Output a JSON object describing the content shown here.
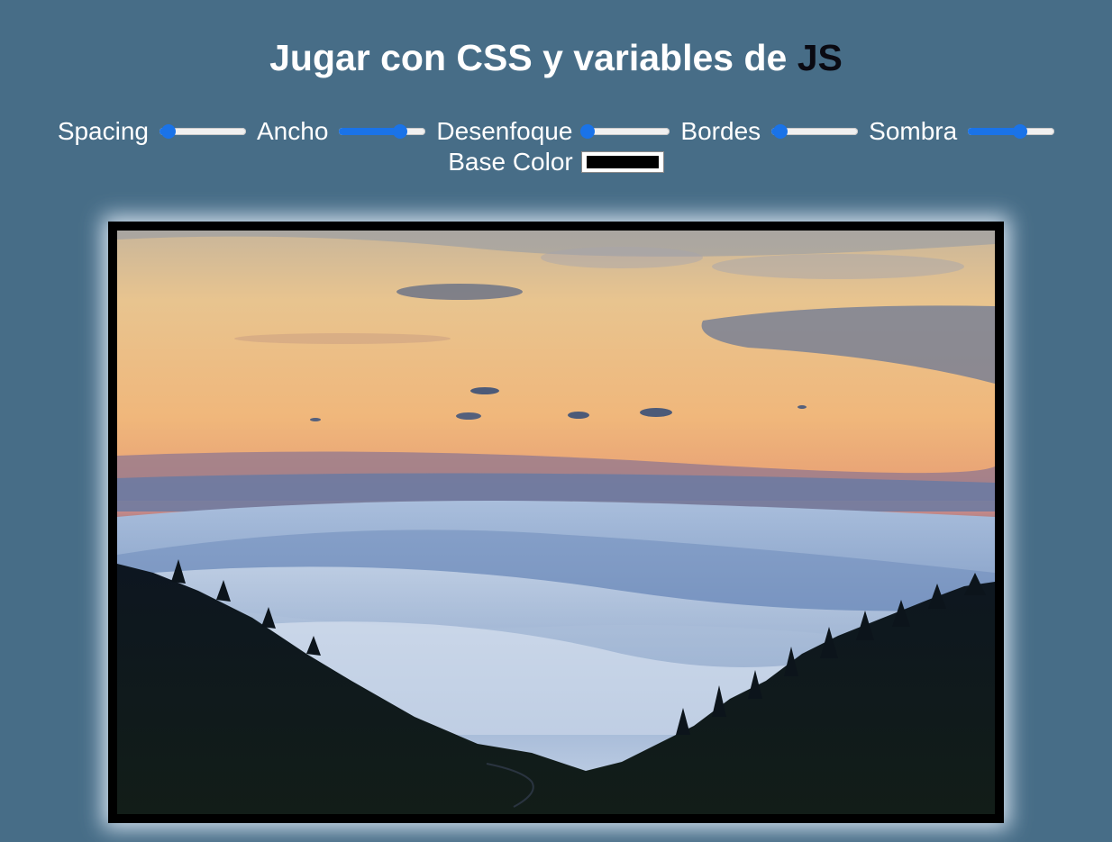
{
  "header": {
    "title_main": "Jugar con CSS y variables de ",
    "title_accent": "JS"
  },
  "controls": [
    {
      "label": "Spacing",
      "value": 0.1
    },
    {
      "label": "Ancho",
      "value": 0.7
    },
    {
      "label": "Desenfoque",
      "value": 0.05
    },
    {
      "label": "Bordes",
      "value": 0.1
    },
    {
      "label": "Sombra",
      "value": 0.6
    }
  ],
  "base_color": {
    "label": "Base Color",
    "value": "#000000"
  },
  "colors": {
    "background": "#476d87",
    "accent": "#1a73e8",
    "title_accent": "#0a0a12"
  },
  "image": {
    "description_icon": "landscape-photo"
  }
}
